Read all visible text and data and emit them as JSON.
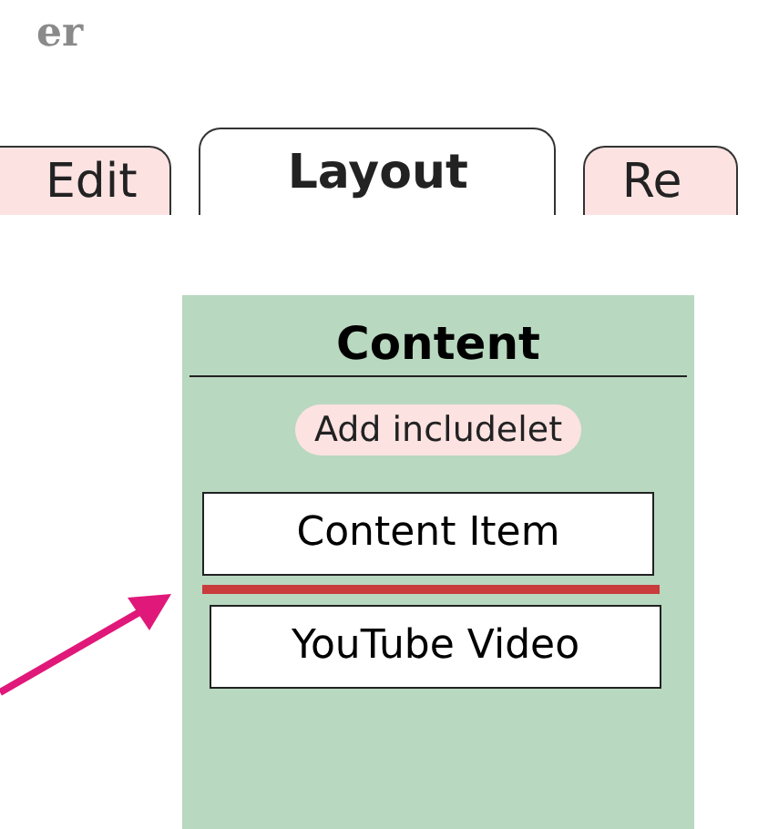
{
  "header": {
    "text": "er"
  },
  "tabs": [
    {
      "label": "Edit",
      "selected": false
    },
    {
      "label": "Layout",
      "selected": true
    },
    {
      "label": "Re",
      "selected": false
    }
  ],
  "panel": {
    "title": "Content",
    "add_button": "Add includelet",
    "items": [
      {
        "label": "Content Item",
        "drop_indicator_after": true
      },
      {
        "label": "YouTube Video",
        "drop_indicator_after": false
      }
    ]
  }
}
